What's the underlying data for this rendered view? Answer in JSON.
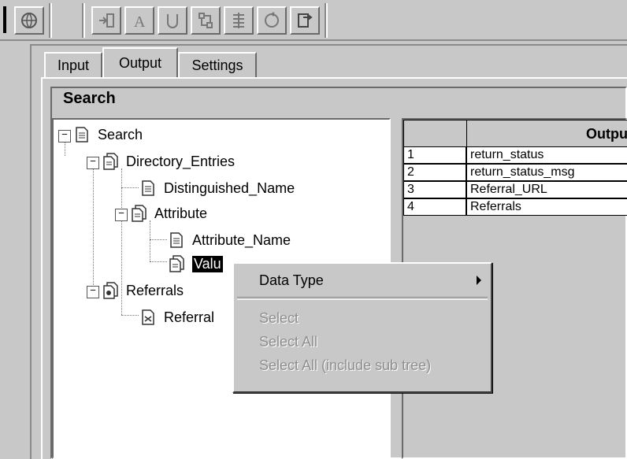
{
  "toolbar": {
    "buttons": [
      "globe-icon",
      "import-icon",
      "text-a-icon",
      "u-shape-icon",
      "tree-icon",
      "list-icon",
      "cycle-icon",
      "export-icon"
    ]
  },
  "tabs": [
    {
      "label": "Input",
      "active": false
    },
    {
      "label": "Output",
      "active": true
    },
    {
      "label": "Settings",
      "active": false
    }
  ],
  "section_title": "Search",
  "tree": {
    "search": "Search",
    "directory_entries": "Directory_Entries",
    "distinguished_name": "Distinguished_Name",
    "attribute": "Attribute",
    "attribute_name": "Attribute_Name",
    "value": "Valu",
    "referrals": "Referrals",
    "referral": "Referral"
  },
  "output_table": {
    "header": "Output",
    "rows": [
      {
        "num": "1",
        "value": "return_status"
      },
      {
        "num": "2",
        "value": "return_status_msg"
      },
      {
        "num": "3",
        "value": "Referral_URL"
      },
      {
        "num": "4",
        "value": "Referrals"
      }
    ]
  },
  "context_menu": {
    "data_type": "Data Type",
    "select": "Select",
    "select_all": "Select All",
    "select_all_sub": "Select All (include sub tree)"
  }
}
